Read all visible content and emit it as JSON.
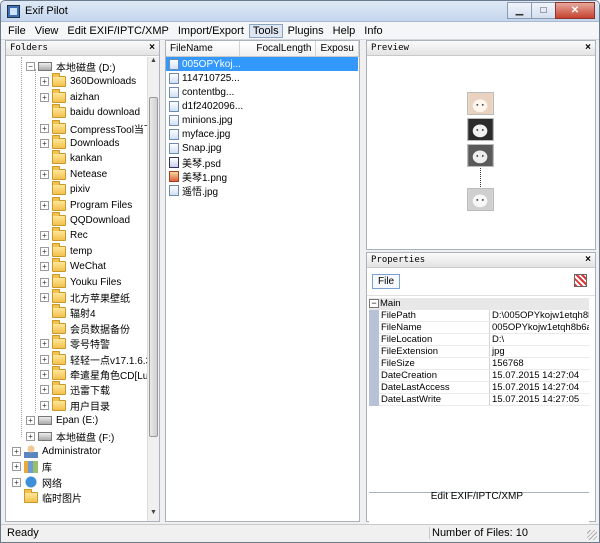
{
  "window": {
    "title": "Exif Pilot"
  },
  "menu": [
    "File",
    "View",
    "Edit EXIF/IPTC/XMP",
    "Import/Export",
    "Tools",
    "Plugins",
    "Help",
    "Info"
  ],
  "folders": {
    "header": "Folders",
    "items": [
      {
        "label": "本地磁盘 (D:)",
        "icon": "drive-icon",
        "expanded": true
      },
      {
        "label": "360Downloads",
        "icon": "folder-icon"
      },
      {
        "label": "aizhan",
        "icon": "folder-icon"
      },
      {
        "label": "baidu download",
        "icon": "folder-icon"
      },
      {
        "label": "CompressTool当下",
        "icon": "folder-icon"
      },
      {
        "label": "Downloads",
        "icon": "folder-icon"
      },
      {
        "label": "kankan",
        "icon": "folder-icon"
      },
      {
        "label": "Netease",
        "icon": "folder-icon"
      },
      {
        "label": "pixiv",
        "icon": "folder-icon"
      },
      {
        "label": "Program Files",
        "icon": "folder-icon"
      },
      {
        "label": "QQDownload",
        "icon": "folder-icon"
      },
      {
        "label": "Rec",
        "icon": "folder-icon"
      },
      {
        "label": "temp",
        "icon": "folder-icon"
      },
      {
        "label": "WeChat",
        "icon": "folder-icon"
      },
      {
        "label": "Youku Files",
        "icon": "folder-icon"
      },
      {
        "label": "北方苹果壁纸",
        "icon": "folder-icon"
      },
      {
        "label": "辐射4",
        "icon": "folder-icon"
      },
      {
        "label": "会员数据备份",
        "icon": "folder-icon"
      },
      {
        "label": "零号特警",
        "icon": "folder-icon"
      },
      {
        "label": "轻轻一点v17.1.6.32",
        "icon": "folder-icon"
      },
      {
        "label": "牵遣星角色CD[Luc",
        "icon": "folder-icon"
      },
      {
        "label": "迅雷下载",
        "icon": "folder-icon"
      },
      {
        "label": "用户目录",
        "icon": "folder-icon"
      },
      {
        "label": "Epan (E:)",
        "icon": "drive-icon"
      },
      {
        "label": "本地磁盘 (F:)",
        "icon": "drive-icon"
      },
      {
        "label": "Administrator",
        "icon": "user-icon"
      },
      {
        "label": "库",
        "icon": "library-icon"
      },
      {
        "label": "网络",
        "icon": "network-icon"
      },
      {
        "label": "临时图片",
        "icon": "folder-icon"
      }
    ]
  },
  "files": {
    "columns": [
      "FileName",
      "FocalLength",
      "Exposu"
    ],
    "rows": [
      {
        "name": "005OPYkoj...",
        "type": "jpg",
        "selected": true
      },
      {
        "name": "114710725...",
        "type": "jpg"
      },
      {
        "name": "contentbg...",
        "type": "jpg"
      },
      {
        "name": "d1f2402096...",
        "type": "jpg"
      },
      {
        "name": "minions.jpg",
        "type": "jpg"
      },
      {
        "name": "myface.jpg",
        "type": "jpg"
      },
      {
        "name": "Snap.jpg",
        "type": "jpg"
      },
      {
        "name": "美琴.psd",
        "type": "psd"
      },
      {
        "name": "美琴1.png",
        "type": "png"
      },
      {
        "name": "遥悟.jpg",
        "type": "jpg"
      }
    ]
  },
  "preview": {
    "header": "Preview"
  },
  "properties": {
    "header": "Properties",
    "tab": "File",
    "category": "Main",
    "rows": [
      {
        "key": "FilePath",
        "value": "D:\\005OPYkojw1etqh8b6at..."
      },
      {
        "key": "FileName",
        "value": "005OPYkojw1etqh8b6at..."
      },
      {
        "key": "FileLocation",
        "value": "D:\\"
      },
      {
        "key": "FileExtension",
        "value": "jpg"
      },
      {
        "key": "FileSize",
        "value": "156768"
      },
      {
        "key": "DateCreation",
        "value": "15.07.2015 14:27:04"
      },
      {
        "key": "DateLastAccess",
        "value": "15.07.2015 14:27:04"
      },
      {
        "key": "DateLastWrite",
        "value": "15.07.2015 14:27:05"
      }
    ],
    "edit_button": "Edit EXIF/IPTC/XMP"
  },
  "status": {
    "left": "Ready",
    "right": "Number of Files: 10"
  }
}
